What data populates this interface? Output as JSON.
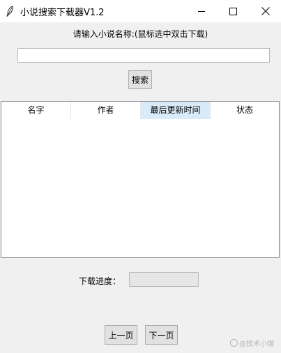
{
  "window": {
    "title": "小说搜索下载器V1.2",
    "icon": "feather-icon"
  },
  "search": {
    "prompt": "请输入小说名称:(鼠标选中双击下载)",
    "value": "",
    "button_label": "搜索"
  },
  "table": {
    "columns": [
      "名字",
      "作者",
      "最后更新时间",
      "状态"
    ],
    "highlighted_column": 2,
    "rows": []
  },
  "progress": {
    "label": "下载进度：",
    "value": 0
  },
  "pagination": {
    "prev_label": "上一页",
    "next_label": "下一页"
  },
  "watermark": {
    "text": "@技术小咖"
  },
  "colors": {
    "titlebar": "#ffffff",
    "window_bg": "#f0f0f0",
    "header_highlight": "#d9ebf9",
    "button_face": "#e1e1e1"
  }
}
